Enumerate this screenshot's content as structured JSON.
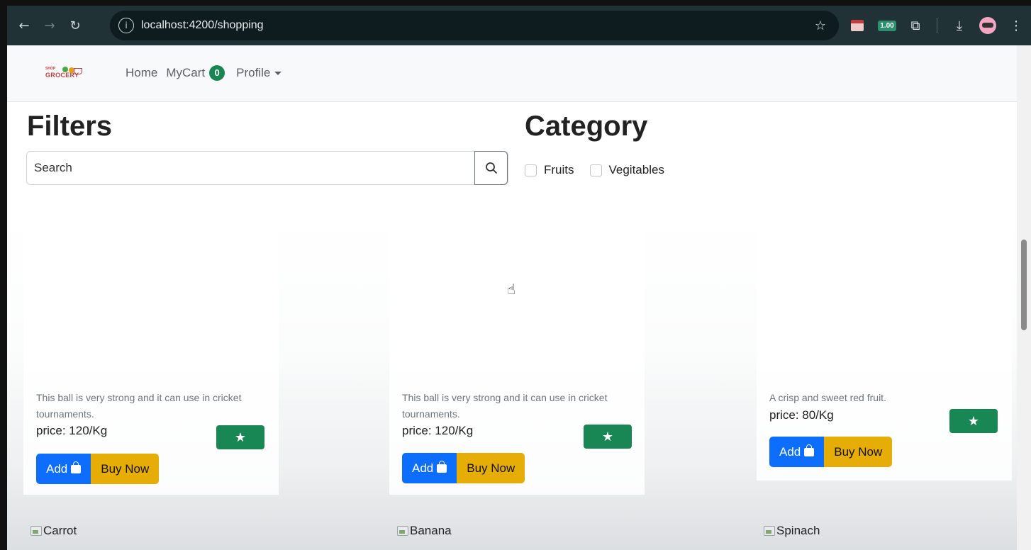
{
  "browser": {
    "url": "localhost:4200/shopping",
    "back_icon": "←",
    "forward_icon": "→",
    "reload_icon": "↻",
    "info_icon": "i",
    "bookmark_icon": "☆",
    "extension_badge": "1.00",
    "puzzle_icon": "⧉",
    "download_icon": "⤓",
    "menu_icon": "⋮"
  },
  "navbar": {
    "logo_top": "SHOP",
    "logo_text": "GROCERY",
    "home": "Home",
    "mycart": "MyCart",
    "cart_count": "0",
    "profile": "Profile"
  },
  "filters": {
    "title": "Filters",
    "search_placeholder": "Search",
    "search_icon": "⚲"
  },
  "category": {
    "title": "Category",
    "options": [
      {
        "label": "Fruits",
        "checked": false
      },
      {
        "label": "Vegitables",
        "checked": false
      }
    ]
  },
  "products": [
    {
      "description": "This ball is very strong and it can use in cricket tournaments.",
      "price": "price: 120/Kg",
      "add_label": "Add",
      "buy_label": "Buy Now",
      "fav_icon": "★"
    },
    {
      "description": "This ball is very strong and it can use in cricket tournaments.",
      "price": "price: 120/Kg",
      "add_label": "Add",
      "buy_label": "Buy Now",
      "fav_icon": "★"
    },
    {
      "description": "A crisp and sweet red fruit.",
      "price": "price: 80/Kg",
      "add_label": "Add",
      "buy_label": "Buy Now",
      "fav_icon": "★"
    }
  ],
  "next_row": [
    {
      "alt": "Carrot"
    },
    {
      "alt": "Banana"
    },
    {
      "alt": "Spinach"
    }
  ],
  "colors": {
    "primary": "#0d6efd",
    "warning": "#e5ad06",
    "success": "#198754",
    "chrome_bg": "#203236"
  }
}
